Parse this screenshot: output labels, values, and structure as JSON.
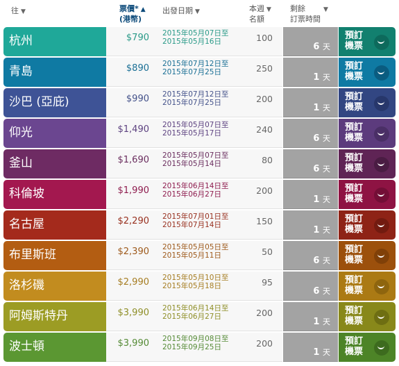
{
  "header": {
    "dest": "往",
    "price": "票價*",
    "price_sub": "(港幣)",
    "date": "出發日期",
    "quota_1": "本週",
    "quota_2": "名額",
    "days_1": "剩餘",
    "days_2": "訂票時間",
    "sort_arrow": "▼",
    "active_arrow": "▲"
  },
  "book_label": "預訂機票",
  "days_unit": "天",
  "rows": [
    {
      "dest": "杭州",
      "price": "$790",
      "date_from": "2015年05月07日至",
      "date_to": "2015年05月16日",
      "quota": "100",
      "days": "6",
      "accent": "#1fa899",
      "book": "#12806f",
      "smile": "#0d6a5c",
      "price_color": "#2a9a88",
      "date_color": "#2a9a88"
    },
    {
      "dest": "青島",
      "price": "$890",
      "date_from": "2015年07月12日至",
      "date_to": "2015年07月25日",
      "quota": "250",
      "days": "1",
      "accent": "#0f7aa3",
      "book": "#0f7aa3",
      "smile": "#0a5c80",
      "price_color": "#1a6f95",
      "date_color": "#1a6f95"
    },
    {
      "dest": "沙巴 (亞庇)",
      "price": "$990",
      "date_from": "2015年07月12日至",
      "date_to": "2015年07月25日",
      "quota": "200",
      "days": "1",
      "accent": "#3e5396",
      "book": "#324682",
      "smile": "#27376b",
      "price_color": "#44528a",
      "date_color": "#44528a"
    },
    {
      "dest": "仰光",
      "price": "$1,490",
      "date_from": "2015年05月07日至",
      "date_to": "2015年05月17日",
      "quota": "240",
      "days": "6",
      "accent": "#6b4690",
      "book": "#5c3b7d",
      "smile": "#4a2f66",
      "price_color": "#5d4280",
      "date_color": "#5d4280"
    },
    {
      "dest": "釜山",
      "price": "$1,690",
      "date_from": "2015年05月07日至",
      "date_to": "2015年05月14日",
      "quota": "80",
      "days": "6",
      "accent": "#6e2b63",
      "book": "#5f2455",
      "smile": "#4a1c43",
      "price_color": "#6a2d5e",
      "date_color": "#6a2d5e"
    },
    {
      "dest": "科倫坡",
      "price": "$1,990",
      "date_from": "2015年06月14日至",
      "date_to": "2015年06月27日",
      "quota": "200",
      "days": "1",
      "accent": "#a3184f",
      "book": "#8e1343",
      "smile": "#730e36",
      "price_color": "#8e1c4e",
      "date_color": "#8e1c4e"
    },
    {
      "dest": "名古屋",
      "price": "$2,290",
      "date_from": "2015年07月01日至",
      "date_to": "2015年07月14日",
      "quota": "150",
      "days": "1",
      "accent": "#a42a1c",
      "book": "#8e2316",
      "smile": "#721b10",
      "price_color": "#98301f",
      "date_color": "#98301f"
    },
    {
      "dest": "布里斯班",
      "price": "$2,390",
      "date_from": "2015年05月05日至",
      "date_to": "2015年05月11日",
      "quota": "50",
      "days": "6",
      "accent": "#b35d12",
      "book": "#9c500c",
      "smile": "#804008",
      "price_color": "#9e5a1c",
      "date_color": "#9e5a1c"
    },
    {
      "dest": "洛杉磯",
      "price": "$2,990",
      "date_from": "2015年05月10日至",
      "date_to": "2015年05月18日",
      "quota": "95",
      "days": "6",
      "accent": "#c28c1f",
      "book": "#ab7a14",
      "smile": "#8e650e",
      "price_color": "#a67d22",
      "date_color": "#a67d22"
    },
    {
      "dest": "阿姆斯特丹",
      "price": "$3,990",
      "date_from": "2015年06月14日至",
      "date_to": "2015年06月27日",
      "quota": "200",
      "days": "1",
      "accent": "#9c9c24",
      "book": "#88881a",
      "smile": "#6e6e12",
      "price_color": "#8f8f28",
      "date_color": "#8f8f28"
    },
    {
      "dest": "波士頓",
      "price": "$3,990",
      "date_from": "2015年09月08日至",
      "date_to": "2015年09月25日",
      "quota": "200",
      "days": "1",
      "accent": "#5b9732",
      "book": "#4d8427",
      "smile": "#3d6b1e",
      "price_color": "#558b36",
      "date_color": "#558b36"
    }
  ]
}
